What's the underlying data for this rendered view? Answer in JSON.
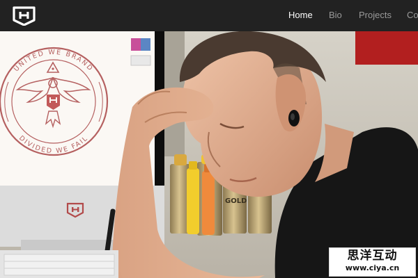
{
  "nav": {
    "brand_icon": "brand-logo-icon",
    "links": [
      {
        "label": "Home",
        "active": true
      },
      {
        "label": "Bio",
        "active": false
      },
      {
        "label": "Projects",
        "active": false
      },
      {
        "label": "Co",
        "active": false
      }
    ]
  },
  "hero": {
    "emblem": {
      "top_text": "UNITED WE BRAND",
      "bottom_text": "DIVIDED WE FAIL"
    },
    "can_label": "GOLD"
  },
  "watermark": {
    "line1": "思洋互动",
    "line2": "www.ciya.cn"
  },
  "colors": {
    "navbar_bg": "#222222",
    "nav_active": "#ffffff",
    "nav_inactive": "#9a9a9a",
    "emblem_red": "#b56060"
  }
}
